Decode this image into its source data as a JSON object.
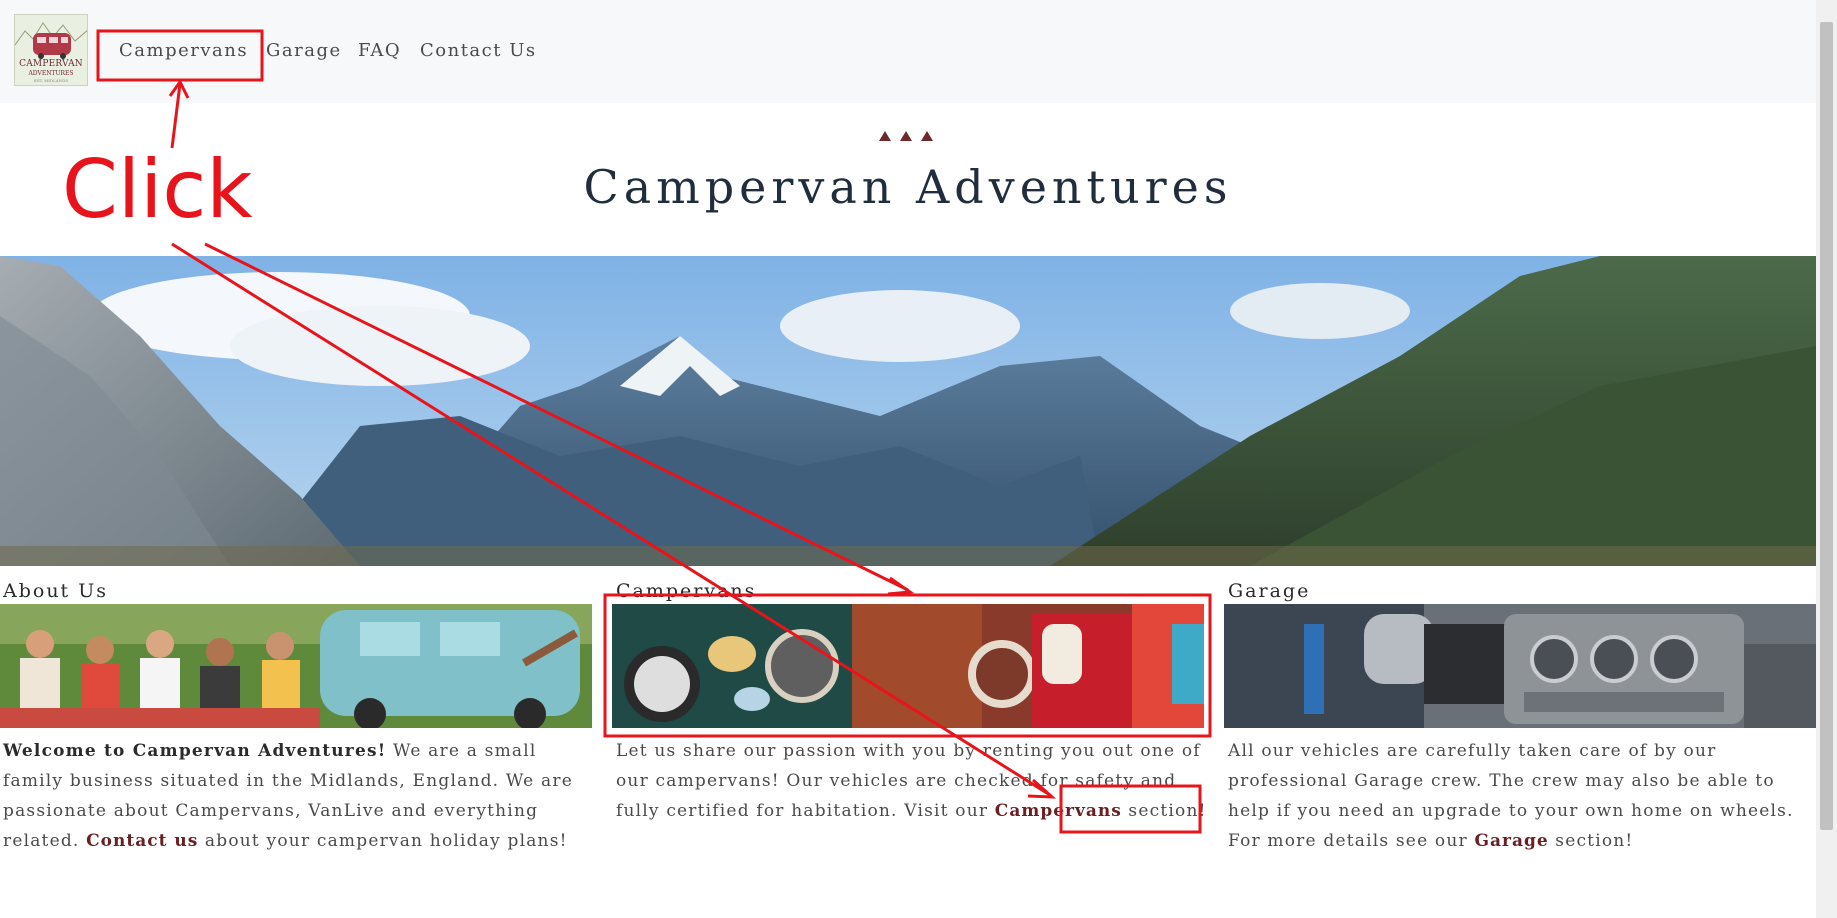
{
  "navbar": {
    "logo": {
      "line1": "CAMPERVAN",
      "line2": "ADVENTURES",
      "line3": "EST. MIDLANDS"
    },
    "links": [
      {
        "label": "Campervans"
      },
      {
        "label": "Garage"
      },
      {
        "label": "FAQ"
      },
      {
        "label": "Contact Us"
      }
    ]
  },
  "header": {
    "title": "Campervan Adventures",
    "ornament": "triangle-ornament-icon"
  },
  "hero": {
    "image": "mountain-valley-photo"
  },
  "columns": {
    "about": {
      "heading": "About Us",
      "image": "friends-picnic-campervan-photo",
      "strong": "Welcome to Campervan Adventures!",
      "text1": " We are a small family business situated in the Midlands, England. We are passionate about Campervans, VanLive and everything related. ",
      "link": "Contact us",
      "text2": " about your campervan holiday plans!"
    },
    "campervans": {
      "heading": "Campervans",
      "image": "vintage-campervans-row-photo",
      "text1": "Let us share our passion with you by renting you out one of our campervans! Our vehicles are checked for safety and fully certified for habitation. Visit our ",
      "link": "Campervans",
      "text2": " section!"
    },
    "garage": {
      "heading": "Garage",
      "image": "engine-garage-photo",
      "text1": "All our vehicles are carefully taken care of by our professional Garage crew. The crew may also be able to help if you need an upgrade to your own home on wheels. For more details see our ",
      "link": "Garage",
      "text2": " section!"
    }
  },
  "annotation": {
    "label": "Click",
    "color": "#e8141b"
  },
  "colors": {
    "nav_bg": "#f7f8fa",
    "title": "#1f2d3d",
    "link": "#6a1f22",
    "ornament": "#6b2b2b"
  }
}
